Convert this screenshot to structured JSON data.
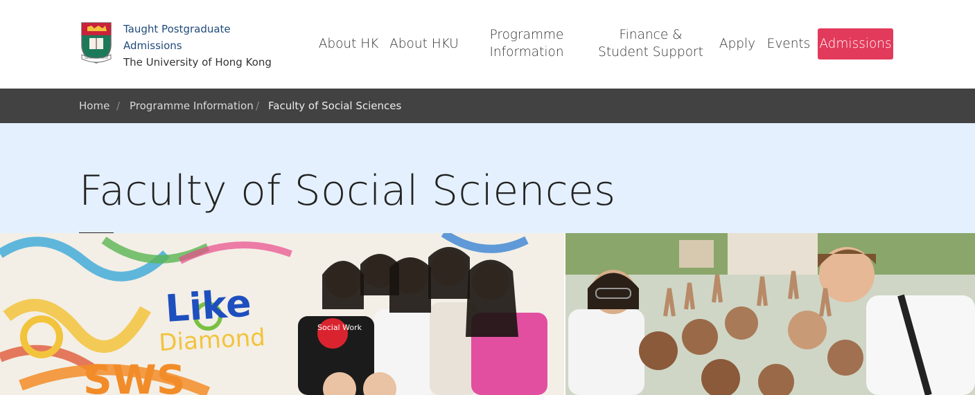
{
  "brand": {
    "line1": "Taught Postgraduate",
    "line2": "Admissions",
    "line3": "The University of Hong Kong",
    "crest_icon": "hku-crest-icon",
    "crest_motto": "SAPIENTIA ET VIRTUS"
  },
  "nav": {
    "items": [
      {
        "label": "About HK"
      },
      {
        "label": "About HKU"
      },
      {
        "label": "Programme Information"
      },
      {
        "label": "Finance & Student Support"
      },
      {
        "label": "Apply"
      },
      {
        "label": "Events"
      },
      {
        "label": "Admissions"
      }
    ]
  },
  "breadcrumb": {
    "items": [
      "Home",
      "Programme Information",
      "Faculty of Social Sciences"
    ],
    "separator": "/"
  },
  "page": {
    "title": "Faculty of Social Sciences"
  },
  "hero": {
    "wall_text": [
      "Like",
      "Diamond",
      "SWS"
    ],
    "shirt_text": "Social Work"
  },
  "colors": {
    "accent": "#e23a5b",
    "brand_blue": "#1f4a7a",
    "breadcrumb_bg": "#424242",
    "title_band_bg": "#e4f0fd"
  }
}
